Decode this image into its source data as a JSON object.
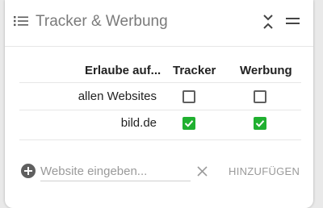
{
  "header": {
    "title": "Tracker & Werbung",
    "icons": {
      "list": "list-icon",
      "collapse": "collapse-icon",
      "menu": "menu-icon"
    }
  },
  "table": {
    "columns": [
      "Erlaube auf...",
      "Tracker",
      "Werbung"
    ],
    "rows": [
      {
        "label": "allen Websites",
        "tracker": false,
        "werbung": false
      },
      {
        "label": "bild.de",
        "tracker": true,
        "werbung": true
      }
    ]
  },
  "add_site": {
    "placeholder": "Website eingeben...",
    "value": "",
    "button_label": "HINZUFÜGEN"
  },
  "colors": {
    "checked": "#20b030",
    "title": "#7a7a7a"
  }
}
